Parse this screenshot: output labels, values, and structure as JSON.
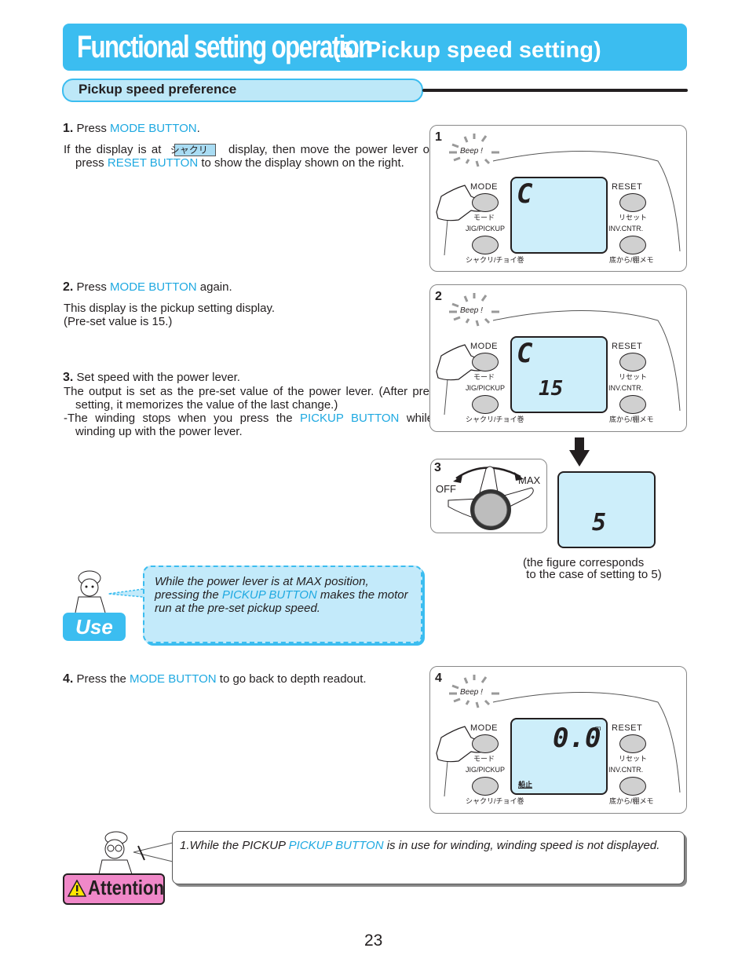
{
  "header": {
    "title": "Functional setting operation",
    "subtitle": "(5. Pickup speed setting)"
  },
  "section": {
    "label": "Pickup speed preference"
  },
  "steps": [
    {
      "number": "1.",
      "lead": "Press ",
      "link": "MODE BUTTON",
      "tail": ".",
      "body_prefix": "If the display is at",
      "chip": "シャクリ",
      "body_mid": "display, then move the power lever or press",
      "body_link": "RESET BUTTON",
      "body_suffix": "to show the display shown on the right."
    },
    {
      "number": "2.",
      "lead": "Press ",
      "link": "MODE BUTTON",
      "tail": " again.",
      "body_line1": "This display is the pickup setting display.",
      "body_line2": "(Pre-set value is 15.)"
    },
    {
      "number": "3.",
      "lead": "Set speed with the power lever.",
      "body_p1": "The output is set as the pre-set value of the power lever. (After pre-setting, it memorizes the value of the last change.)",
      "body_p2_prefix": "-The winding stops when you press the",
      "body_p2_link": "PICKUP BUTTON",
      "body_p2_suffix": "while winding up with the power lever."
    },
    {
      "number": "4.",
      "lead": "Press the ",
      "link": "MODE BUTTON",
      "tail": " to go back to depth readout."
    }
  ],
  "panels": {
    "common": {
      "beep": "Beep !",
      "mode": "MODE",
      "mode_jp": "モード",
      "reset": "RESET",
      "reset_jp": "リセット",
      "jig": "JIG/PICKUP",
      "jig_jp": "シャクリ/チョイ巻",
      "inv": "INV.CNTR.",
      "inv_jp": "底から/棚メモ"
    },
    "p1": {
      "number": "1",
      "lcd_top": "C",
      "lcd_bottom": ""
    },
    "p2": {
      "number": "2",
      "lcd_top": "C",
      "lcd_bottom": "15"
    },
    "p3": {
      "number": "3",
      "off": "OFF",
      "max": "MAX",
      "lcd_value": "5",
      "caption_line1": "(the figure corresponds",
      "caption_line2": " to the case of setting to 5)"
    },
    "p4": {
      "number": "4",
      "lcd_value": "0.0",
      "unit": "m",
      "status": "船止"
    }
  },
  "use_callout": {
    "badge": "Use",
    "text_prefix": "While the power lever is at MAX position, pressing the",
    "link": "PICKUP BUTTON",
    "text_suffix": "makes the motor run at the pre-set pickup speed."
  },
  "attention_callout": {
    "badge": "Attention",
    "text_prefix": "1.While the PICKUP",
    "link": "PICKUP BUTTON",
    "text_suffix": "is in use for winding, winding speed is not displayed."
  },
  "page_number": "23"
}
